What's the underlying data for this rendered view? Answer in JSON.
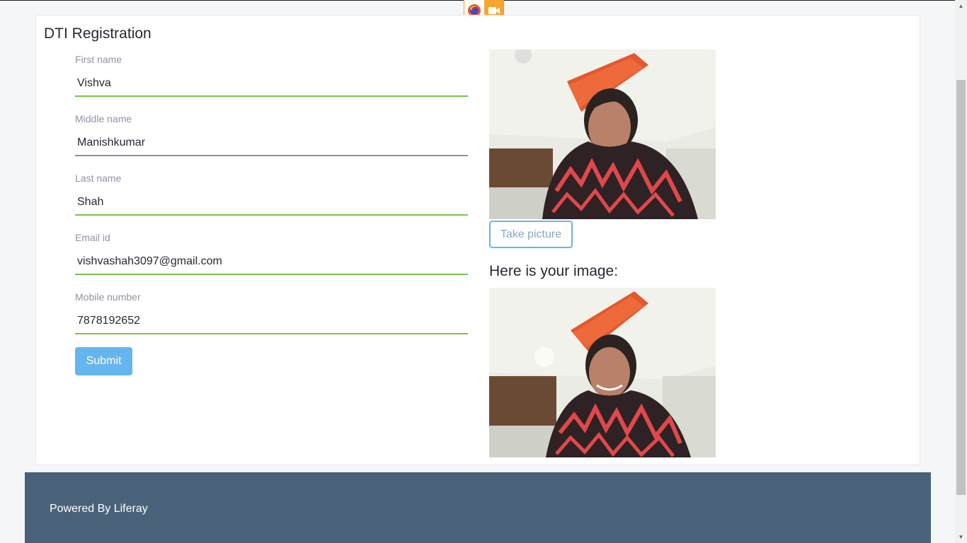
{
  "form": {
    "title": "DTI Registration",
    "fields": [
      {
        "label": "First name",
        "value": "Vishva"
      },
      {
        "label": "Middle name",
        "value": "Manishkumar"
      },
      {
        "label": "Last name",
        "value": "Shah"
      },
      {
        "label": "Email id",
        "value": "vishvashah3097@gmail.com"
      },
      {
        "label": "Mobile number",
        "value": "7878192652"
      }
    ],
    "submit_label": "Submit"
  },
  "camera": {
    "take_picture_label": "Take picture",
    "result_heading": "Here is your image:"
  },
  "footer": {
    "text": "Powered By Liferay"
  },
  "icons": {
    "browser": "firefox-icon",
    "sharing": "camera-icon",
    "scroll_up": "scroll-up-arrow-icon",
    "scroll_down": "scroll-down-arrow-icon"
  },
  "colors": {
    "accent": "#65b5ee",
    "valid_underline": "#7cc24c",
    "footer_bg": "#4a6279",
    "share_indicator": "#f6a531"
  }
}
